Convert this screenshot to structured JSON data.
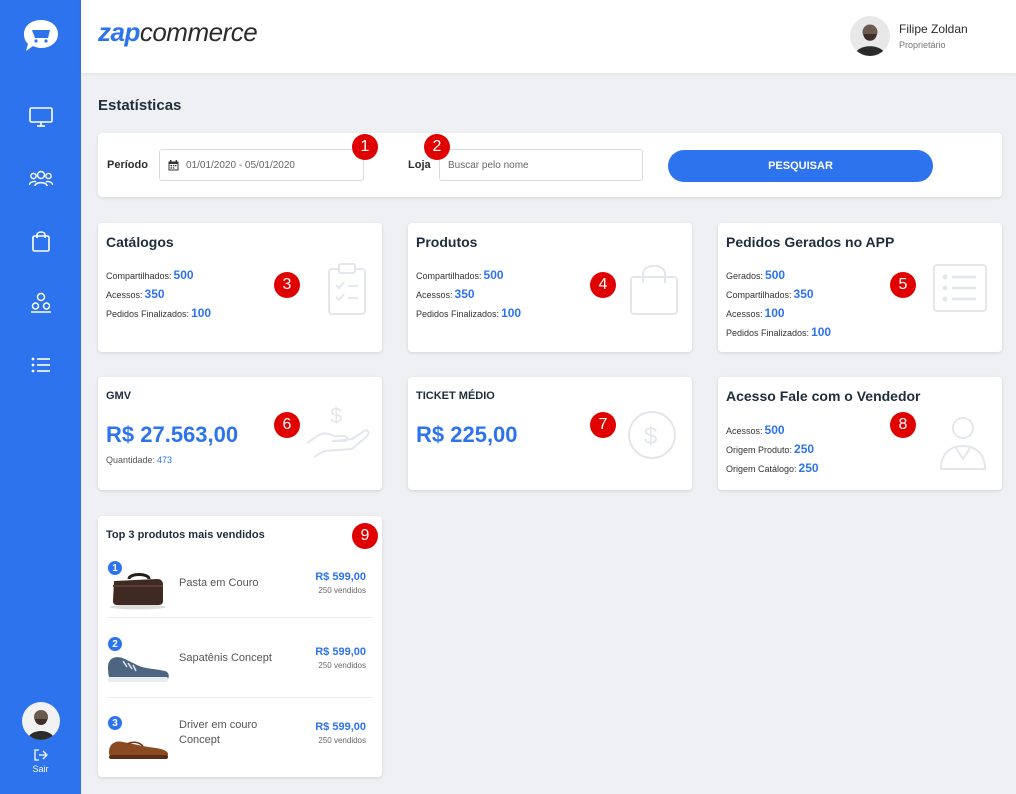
{
  "app": {
    "brand_part1": "zap",
    "brand_part2": "commerce"
  },
  "sidebar": {
    "items": [
      {
        "icon": "monitor-icon"
      },
      {
        "icon": "users-icon"
      },
      {
        "icon": "shopping-bag-icon"
      },
      {
        "icon": "team-icon"
      },
      {
        "icon": "list-icon"
      }
    ],
    "logout_label": "Sair"
  },
  "user": {
    "name": "Filipe Zoldan",
    "role": "Proprietário"
  },
  "page": {
    "title": "Estatísticas"
  },
  "filter": {
    "period_label": "Período",
    "period_value": "01/01/2020 - 05/01/2020",
    "store_label": "Loja",
    "store_placeholder": "Buscar pelo nome",
    "search_button": "PESQUISAR"
  },
  "cards": {
    "catalogos": {
      "title": "Catálogos",
      "stats": [
        {
          "label": "Compartilhados:",
          "value": "500"
        },
        {
          "label": "Acessos:",
          "value": "350"
        },
        {
          "label": "Pedidos Finalizados:",
          "value": "100"
        }
      ]
    },
    "produtos": {
      "title": "Produtos",
      "stats": [
        {
          "label": "Compartilhados:",
          "value": "500"
        },
        {
          "label": "Acessos:",
          "value": "350"
        },
        {
          "label": "Pedidos Finalizados:",
          "value": "100"
        }
      ]
    },
    "pedidos": {
      "title": "Pedidos Gerados no APP",
      "stats": [
        {
          "label": "Gerados:",
          "value": "500"
        },
        {
          "label": "Compartilhados:",
          "value": "350"
        },
        {
          "label": "Acessos:",
          "value": "100"
        },
        {
          "label": "Pedidos Finalizados:",
          "value": "100"
        }
      ]
    },
    "gmv": {
      "title": "GMV",
      "value": "R$ 27.563,00",
      "qty_label": "Quantidade:",
      "qty_value": "473"
    },
    "ticket": {
      "title": "TICKET MÉDIO",
      "value": "R$ 225,00"
    },
    "acesso": {
      "title": "Acesso Fale com o Vendedor",
      "stats": [
        {
          "label": "Acessos:",
          "value": "500"
        },
        {
          "label": "Origem Produto:",
          "value": "250"
        },
        {
          "label": "Origem Catálogo:",
          "value": "250"
        }
      ]
    },
    "top": {
      "title": "Top 3 produtos mais vendidos",
      "items": [
        {
          "rank": "1",
          "name": "Pasta em Couro",
          "price": "R$ 599,00",
          "sold": "250 vendidos"
        },
        {
          "rank": "2",
          "name": "Sapatênis Concept",
          "price": "R$ 599,00",
          "sold": "250 vendidos"
        },
        {
          "rank": "3",
          "name": "Driver em couro Concept",
          "price": "R$ 599,00",
          "sold": "250 vendidos"
        }
      ]
    }
  },
  "markers": [
    "1",
    "2",
    "3",
    "4",
    "5",
    "6",
    "7",
    "8",
    "9"
  ],
  "colors": {
    "primary": "#2d73ee",
    "marker": "#e00000",
    "background": "#eef0f4"
  }
}
